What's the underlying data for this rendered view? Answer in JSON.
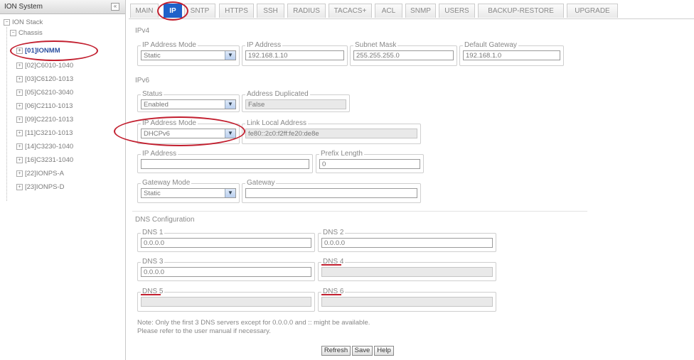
{
  "tree": {
    "title": "ION System",
    "collapse_symbol": "«",
    "root": "ION Stack",
    "chassis": "Chassis",
    "items": [
      {
        "label": "[01]IONMM",
        "selected": true
      },
      {
        "label": "[02]C6010-1040",
        "selected": false
      },
      {
        "label": "[03]C6120-1013",
        "selected": false
      },
      {
        "label": "[05]C6210-3040",
        "selected": false
      },
      {
        "label": "[06]C2110-1013",
        "selected": false
      },
      {
        "label": "[09]C2210-1013",
        "selected": false
      },
      {
        "label": "[11]C3210-1013",
        "selected": false
      },
      {
        "label": "[14]C3230-1040",
        "selected": false
      },
      {
        "label": "[16]C3231-1040",
        "selected": false
      },
      {
        "label": "[22]IONPS-A",
        "selected": false
      },
      {
        "label": "[23]IONPS-D",
        "selected": false
      }
    ]
  },
  "tabs": [
    "MAIN",
    "IP",
    "SNTP",
    "HTTPS",
    "SSH",
    "RADIUS",
    "TACACS+",
    "ACL",
    "SNMP",
    "USERS",
    "BACKUP-RESTORE",
    "UPGRADE"
  ],
  "active_tab": "IP",
  "ipv4": {
    "section": "IPv4",
    "mode_label": "IP Address Mode",
    "mode_value": "Static",
    "address_label": "IP Address",
    "address_value": "192.168.1.10",
    "mask_label": "Subnet Mask",
    "mask_value": "255.255.255.0",
    "gateway_label": "Default Gateway",
    "gateway_value": "192.168.1.0"
  },
  "ipv6": {
    "section": "IPv6",
    "status_label": "Status",
    "status_value": "Enabled",
    "dup_label": "Address Duplicated",
    "dup_value": "False",
    "mode_label": "IP Address Mode",
    "mode_value": "DHCPv6",
    "link_label": "Link Local Address",
    "link_value": "fe80::2c0:f2ff:fe20:de8e",
    "address_label": "IP Address",
    "address_value": "",
    "prefix_label": "Prefix Length",
    "prefix_value": "0",
    "gw_mode_label": "Gateway Mode",
    "gw_mode_value": "Static",
    "gateway_label": "Gateway",
    "gateway_value": ""
  },
  "dns": {
    "section": "DNS Configuration",
    "dns1_label": "DNS 1",
    "dns1_value": "0.0.0.0",
    "dns2_label": "DNS 2",
    "dns2_value": "0.0.0.0",
    "dns3_label": "DNS 3",
    "dns3_value": "0.0.0.0",
    "dns4_label": "DNS 4",
    "dns4_value": "",
    "dns5_label": "DNS 5",
    "dns5_value": "",
    "dns6_label": "DNS 6",
    "dns6_value": ""
  },
  "notes": {
    "line1": "Note: Only the first 3 DNS servers except for 0.0.0.0 and :: might be available.",
    "line2": "Please refer to the user manual if necessary."
  },
  "buttons": {
    "refresh": "Refresh",
    "save": "Save",
    "help": "Help"
  },
  "annotation_color": "#c21f2f",
  "active_tab_color": "#1f61c9"
}
